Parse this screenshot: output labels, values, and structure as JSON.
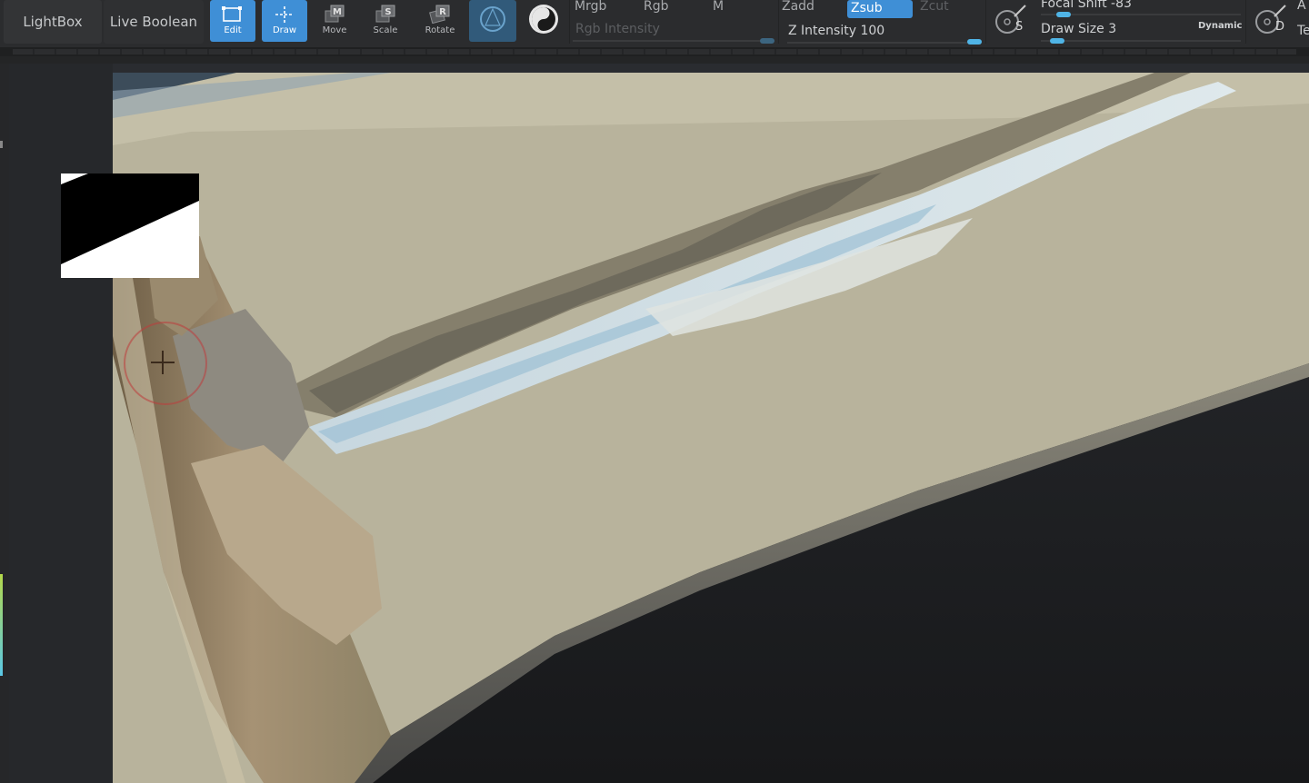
{
  "shelf": {
    "lightbox_label": "LightBox",
    "live_boolean_label": "Live Boolean",
    "tools": [
      {
        "label": "Edit",
        "icon": "edit-icon",
        "active": true
      },
      {
        "label": "Draw",
        "icon": "draw-icon",
        "active": true
      },
      {
        "label": "Move",
        "icon": "move-icon",
        "active": false
      },
      {
        "label": "Scale",
        "icon": "scale-icon",
        "active": false
      },
      {
        "label": "Rotate",
        "icon": "rotate-icon",
        "active": false
      }
    ],
    "material_modes": [
      {
        "label": "Mrgb",
        "state": "normal"
      },
      {
        "label": "Rgb",
        "state": "normal"
      },
      {
        "label": "M",
        "state": "normal"
      }
    ],
    "rgb_intensity_label": "Rgb Intensity",
    "z_modes": [
      {
        "label": "Zadd",
        "state": "normal"
      },
      {
        "label": "Zsub",
        "state": "active"
      },
      {
        "label": "Zcut",
        "state": "dim"
      }
    ],
    "z_intensity_label": "Z Intensity",
    "z_intensity_value": "100",
    "z_intensity_level": 1.0,
    "focal_shift_label": "Focal Shift",
    "focal_shift_value": "-83",
    "focal_shift_level": 0.085,
    "draw_size_label": "Draw Size",
    "draw_size_value": "3",
    "draw_size_level": 0.05,
    "dynamic_label": "Dynamic",
    "s_button_letter": "S",
    "d_button_letter": "D",
    "edge_letter_top": "A",
    "edge_letter_bottom": "Te"
  },
  "colors": {
    "accent": "#3f8fd6",
    "slider_knob": "#4fb4e6",
    "mesh_clay": "#b8b39c",
    "background": "#1c1d1f"
  }
}
